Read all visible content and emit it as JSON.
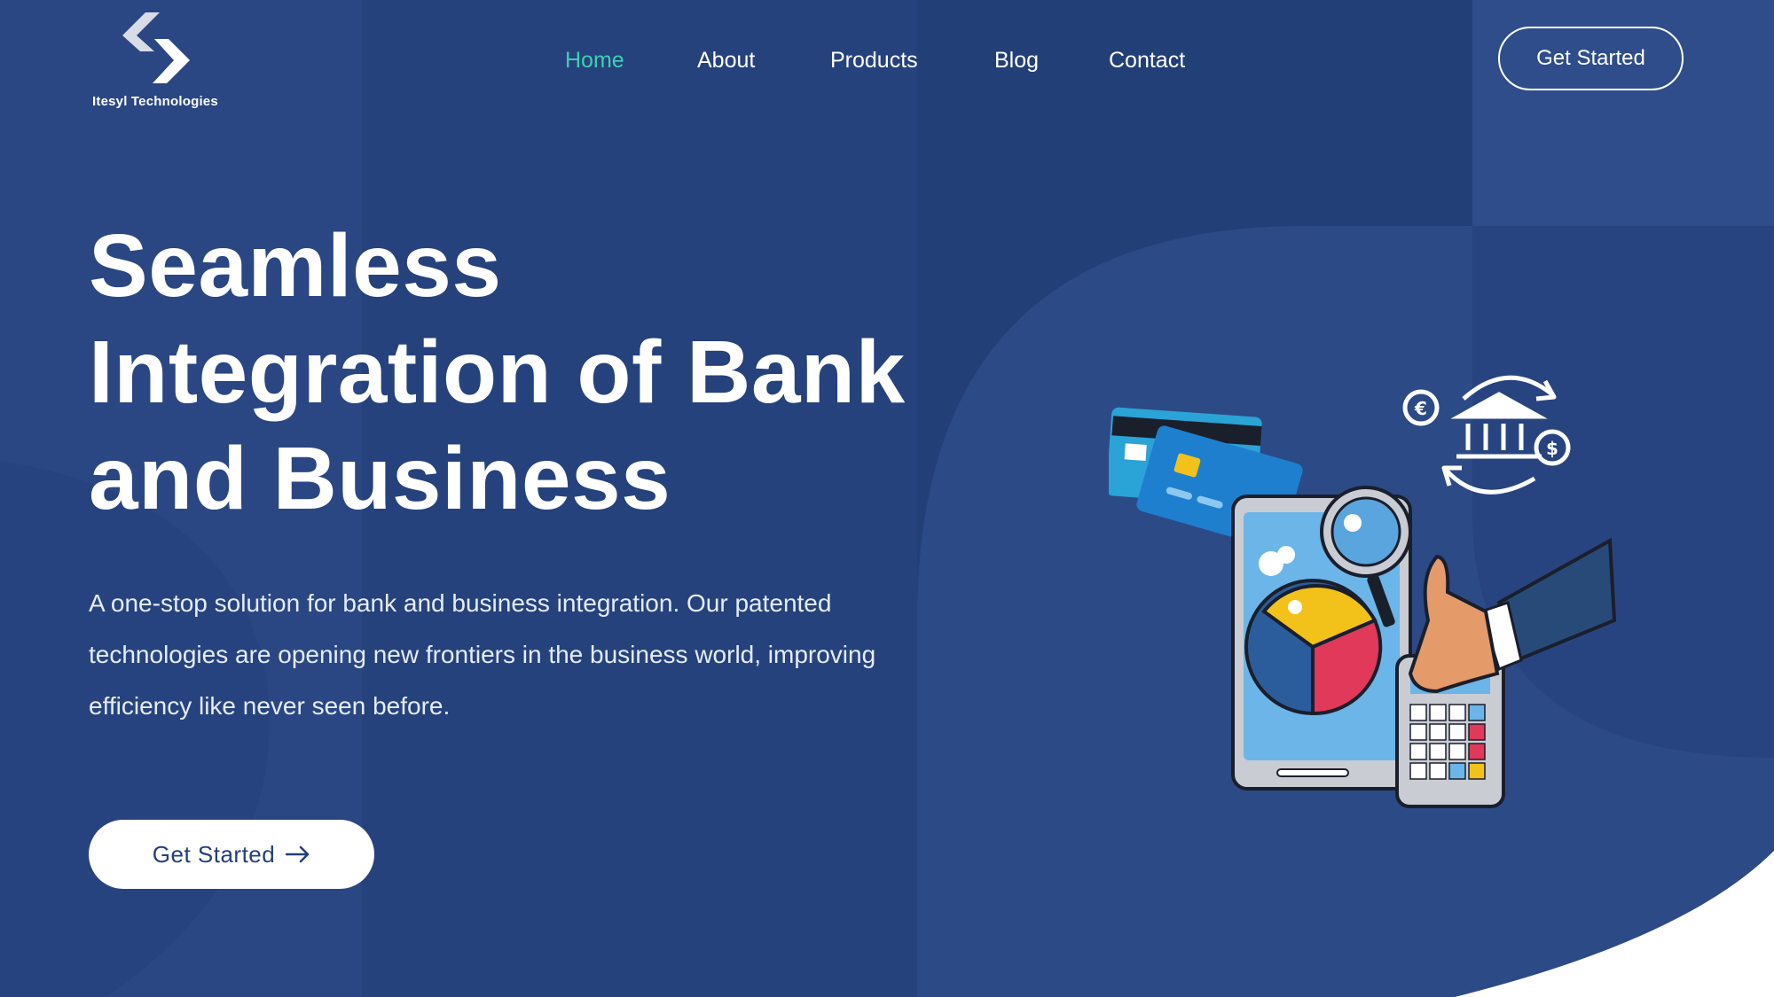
{
  "brand": {
    "name": "Itesyl Technologies",
    "logo_icon": "double-chevron-logo-icon"
  },
  "nav": {
    "items": [
      {
        "label": "Home",
        "active": true
      },
      {
        "label": "About",
        "active": false
      },
      {
        "label": "Products",
        "active": false
      },
      {
        "label": "Blog",
        "active": false
      },
      {
        "label": "Contact",
        "active": false
      }
    ],
    "cta_label": "Get Started"
  },
  "hero": {
    "title_lines": [
      "Seamless",
      "Integration of Bank",
      "and Business"
    ],
    "subtitle_lines": [
      "A one-stop solution for bank and business integration. Our patented",
      "technologies are opening new frontiers in the business world, improving",
      "efficiency like never seen before."
    ],
    "cta_label": "Get Started",
    "cta_icon": "arrow-right-icon"
  },
  "colors": {
    "background": "#233f78",
    "accent": "#3fd0b0",
    "text": "#ffffff"
  }
}
